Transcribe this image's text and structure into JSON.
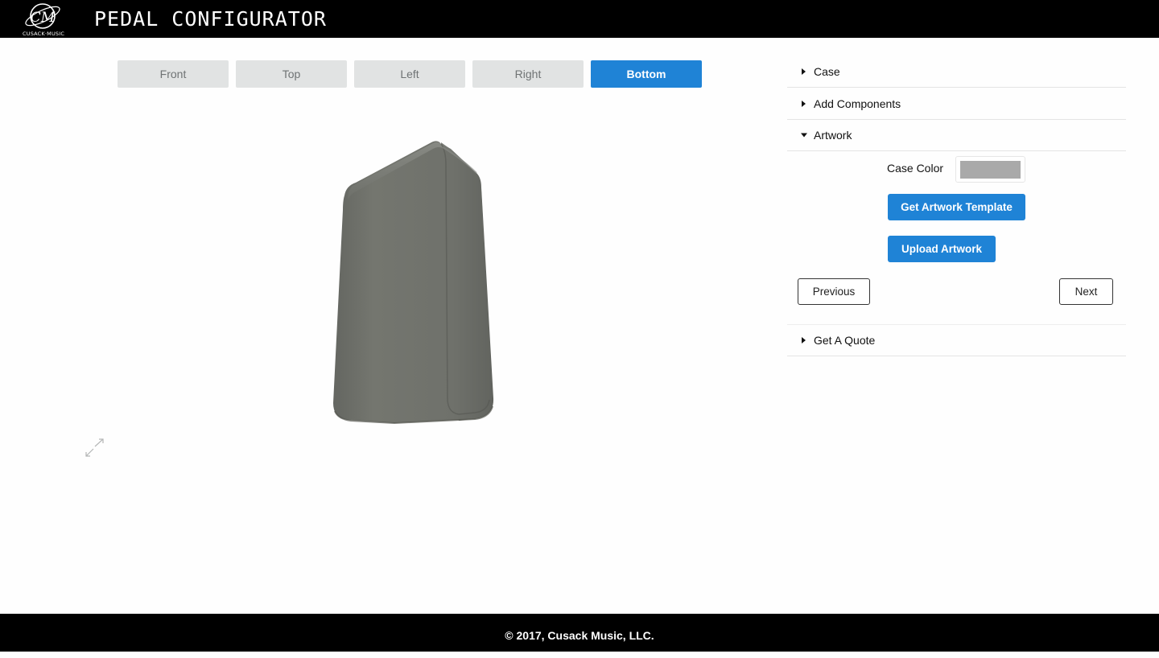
{
  "header": {
    "title": "PEDAL CONFIGURATOR",
    "logo_text": "CUSACK·MUSIC",
    "logo_monogram": "CM"
  },
  "views": {
    "tabs": [
      "Front",
      "Top",
      "Left",
      "Right",
      "Bottom"
    ],
    "active": "Bottom"
  },
  "accordion": {
    "case_label": "Case",
    "components_label": "Add Components",
    "artwork_label": "Artwork",
    "quote_label": "Get A Quote"
  },
  "artwork": {
    "case_color_label": "Case Color",
    "case_color_value": "#a9a9a9",
    "template_button": "Get Artwork Template",
    "upload_button": "Upload Artwork",
    "previous_button": "Previous",
    "next_button": "Next"
  },
  "footer": {
    "copyright": "© 2017, Cusack Music, LLC."
  },
  "colors": {
    "accent": "#1f83d6",
    "tab_inactive_bg": "#e1e3e3",
    "pedal_body": "#6e706b"
  },
  "icons": {
    "fullscreen": "expand-arrows-icon",
    "accordion_collapsed": "caret-right-icon",
    "accordion_expanded": "caret-down-icon"
  }
}
